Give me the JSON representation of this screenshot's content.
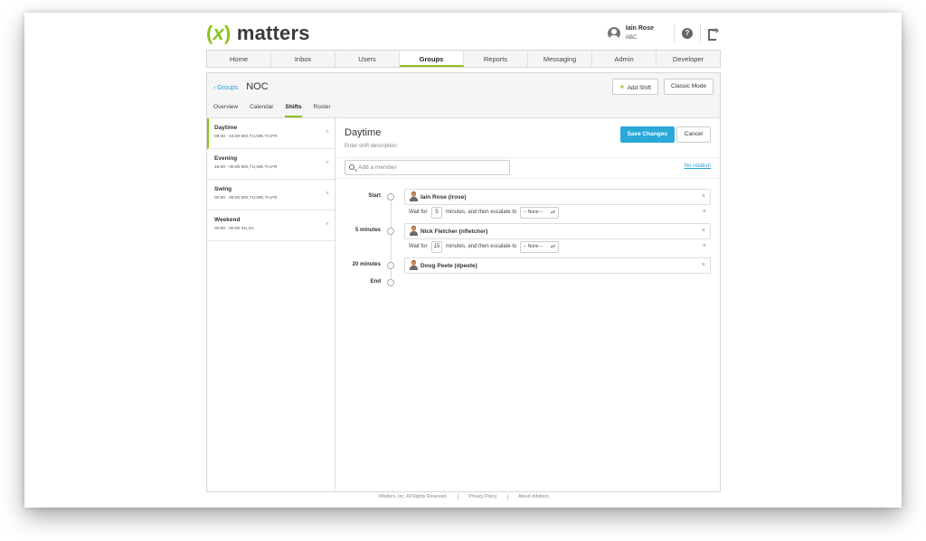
{
  "brand": {
    "logo_paren_open": "(",
    "logo_x": "x",
    "logo_paren_close": ")",
    "logo_word": "matters"
  },
  "user": {
    "name": "Iain Rose",
    "sub": "ABC"
  },
  "nav": [
    "Home",
    "Inbox",
    "Users",
    "Groups",
    "Reports",
    "Messaging",
    "Admin",
    "Developer"
  ],
  "nav_active": "Groups",
  "header": {
    "breadcrumb_link": "‹ Groups",
    "title": "NOC",
    "add_shift_label": "Add Shift",
    "classic_mode_label": "Classic Mode"
  },
  "subtabs": [
    "Overview",
    "Calendar",
    "Shifts",
    "Roster"
  ],
  "subtab_active": "Shifts",
  "shifts": [
    {
      "name": "Daytime",
      "time": "08:00 - 16:00 MO,TU,WE,TH,FR"
    },
    {
      "name": "Evening",
      "time": "16:00 - 00:00 MO,TU,WE,TH,FR"
    },
    {
      "name": "Swing",
      "time": "00:00 - 08:00 MO,TU,WE,TH,FR"
    },
    {
      "name": "Weekend",
      "time": "00:00 - 00:00 SU,SA"
    }
  ],
  "editor": {
    "title": "Daytime",
    "description_placeholder": "Enter shift description",
    "save_label": "Save Changes",
    "cancel_label": "Cancel",
    "member_placeholder": "Add a member",
    "no_rotation": "No rotation"
  },
  "timeline": {
    "stages": [
      {
        "label": "Start",
        "member": "Iain Rose (irose)"
      },
      {
        "label": "5 minutes",
        "member": "Nick Fletcher (nfletcher)"
      },
      {
        "label": "20 minutes",
        "member": "Doug Peete (dpeete)"
      },
      {
        "label": "End"
      }
    ],
    "escalations": [
      {
        "wait_for": "Wait for",
        "minutes": "5",
        "then": "minutes, and then escalate to",
        "select": "-- None --"
      },
      {
        "wait_for": "Wait for",
        "minutes": "15",
        "then": "minutes, and then escalate to",
        "select": "-- None --"
      }
    ]
  },
  "footer": {
    "copyright": "xMatters, Inc. All Rights Reserved.",
    "privacy": "Privacy Policy",
    "about": "About xMatters"
  },
  "colors": {
    "accent": "#8cc21d",
    "primary": "#2aa8d8",
    "link": "#2a9fd6"
  }
}
